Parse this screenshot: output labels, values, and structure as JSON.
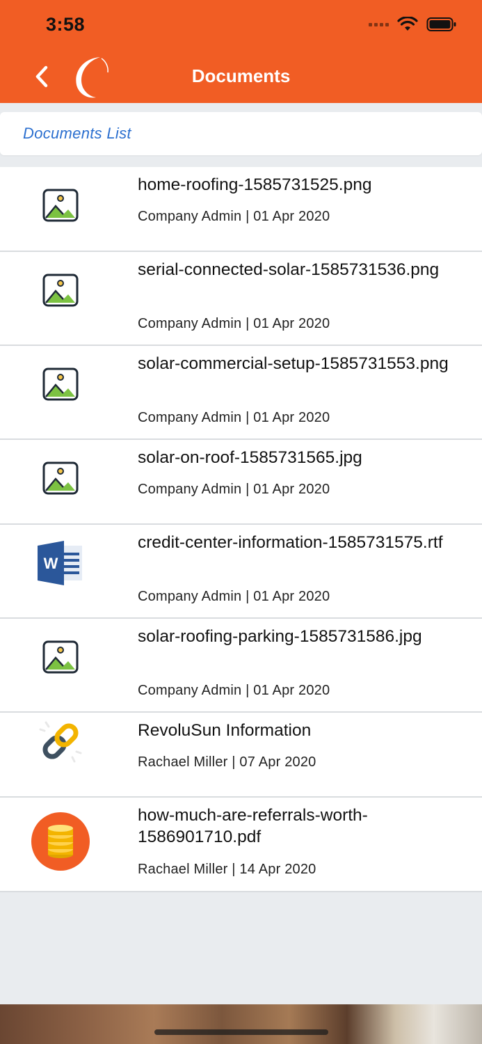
{
  "status_bar": {
    "time": "3:58"
  },
  "header": {
    "title": "Documents"
  },
  "section": {
    "label": "Documents List"
  },
  "documents": [
    {
      "name": "home-roofing-1585731525.png",
      "meta": "Company Admin | 01 Apr 2020",
      "icon": "image-file-icon"
    },
    {
      "name": "serial-connected-solar-1585731536.png",
      "meta": "Company Admin | 01 Apr 2020",
      "icon": "image-file-icon"
    },
    {
      "name": "solar-commercial-setup-1585731553.png",
      "meta": "Company Admin | 01 Apr 2020",
      "icon": "image-file-icon"
    },
    {
      "name": "solar-on-roof-1585731565.jpg",
      "meta": "Company Admin | 01 Apr 2020",
      "icon": "image-file-icon"
    },
    {
      "name": "credit-center-information-1585731575.rtf",
      "meta": "Company Admin | 01 Apr 2020",
      "icon": "word-document-icon"
    },
    {
      "name": "solar-roofing-parking-1585731586.jpg",
      "meta": "Company Admin | 01 Apr 2020",
      "icon": "image-file-icon"
    },
    {
      "name": "RevoluSun Information",
      "meta": "Rachael Miller | 07 Apr 2020",
      "icon": "link-icon"
    },
    {
      "name": "how-much-are-referrals-worth-1586901710.pdf",
      "meta": "Rachael Miller | 14 Apr 2020",
      "icon": "coins-icon"
    }
  ],
  "colors": {
    "header": "#f15d24",
    "link_blue": "#2b6fcf",
    "background": "#e9ecef"
  }
}
